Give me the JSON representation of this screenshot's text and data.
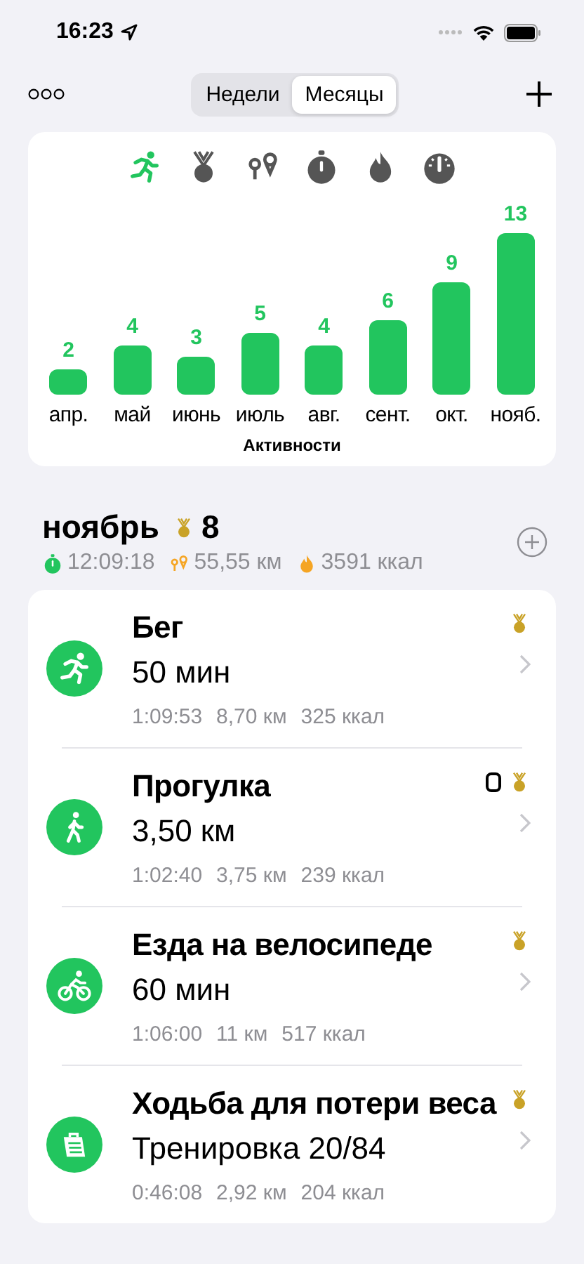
{
  "status_bar": {
    "time": "16:23"
  },
  "nav": {
    "tabs": [
      {
        "label": "Недели",
        "selected": false
      },
      {
        "label": "Месяцы",
        "selected": true
      }
    ]
  },
  "chart_card": {
    "metrics": [
      {
        "kind": "run",
        "selected": true
      },
      {
        "kind": "medal",
        "selected": false
      },
      {
        "kind": "distance",
        "selected": false
      },
      {
        "kind": "timer",
        "selected": false
      },
      {
        "kind": "calories",
        "selected": false
      },
      {
        "kind": "speed",
        "selected": false
      }
    ],
    "chart_data": {
      "type": "bar",
      "xlabel": "Активности",
      "categories": [
        "апр.",
        "май",
        "июнь",
        "июль",
        "авг.",
        "сент.",
        "окт.",
        "нояб."
      ],
      "series": [
        {
          "color": "#22c55e",
          "values": [
            2,
            4,
            3,
            5,
            4,
            6,
            9,
            13
          ]
        }
      ],
      "data_labels": true
    }
  },
  "month": {
    "title": "ноябрь",
    "medals": "8",
    "stats": [
      {
        "kind": "time",
        "text": "12:09:18"
      },
      {
        "kind": "distance",
        "text": "55,55 км"
      },
      {
        "kind": "calories",
        "text": "3591 ккал"
      }
    ]
  },
  "activities": [
    {
      "kind": "run",
      "title": "Бег",
      "subtitle": "50 мин",
      "stats": [
        "1:09:53",
        "8,70 км",
        "325 ккал"
      ],
      "watch": false,
      "medal": true
    },
    {
      "kind": "walk",
      "title": "Прогулка",
      "subtitle": "3,50 км",
      "stats": [
        "1:02:40",
        "3,75 км",
        "239 ккал"
      ],
      "watch": true,
      "medal": true
    },
    {
      "kind": "bike",
      "title": "Езда на велосипеде",
      "subtitle": "60 мин",
      "stats": [
        "1:06:00",
        "11 км",
        "517 ккал"
      ],
      "watch": false,
      "medal": true
    },
    {
      "kind": "plan",
      "title": "Ходьба для потери веса",
      "subtitle": "Тренировка 20/84",
      "stats": [
        "0:46:08",
        "2,92 км",
        "204 ккал"
      ],
      "watch": false,
      "medal": true
    }
  ]
}
